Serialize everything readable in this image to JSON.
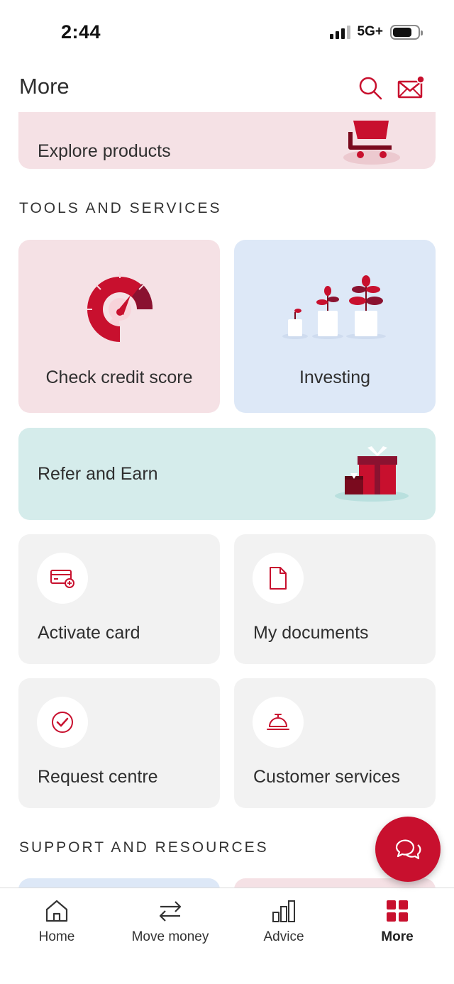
{
  "status_bar": {
    "time": "2:44",
    "network": "5G+"
  },
  "header": {
    "title": "More"
  },
  "banner": {
    "label": "Explore products"
  },
  "sections": {
    "tools": "TOOLS AND SERVICES",
    "support": "SUPPORT AND RESOURCES"
  },
  "tiles": {
    "credit": "Check credit score",
    "investing": "Investing",
    "refer": "Refer and Earn",
    "activate": "Activate card",
    "documents": "My documents",
    "request": "Request centre",
    "customer_services": "Customer services"
  },
  "nav": {
    "home": "Home",
    "move_money": "Move money",
    "advice": "Advice",
    "more": "More"
  },
  "colors": {
    "accent": "#c8102e",
    "pink_tile": "#f5e1e5",
    "blue_tile": "#dde8f7",
    "teal_tile": "#d5eceb",
    "grey_tile": "#f2f2f2"
  }
}
